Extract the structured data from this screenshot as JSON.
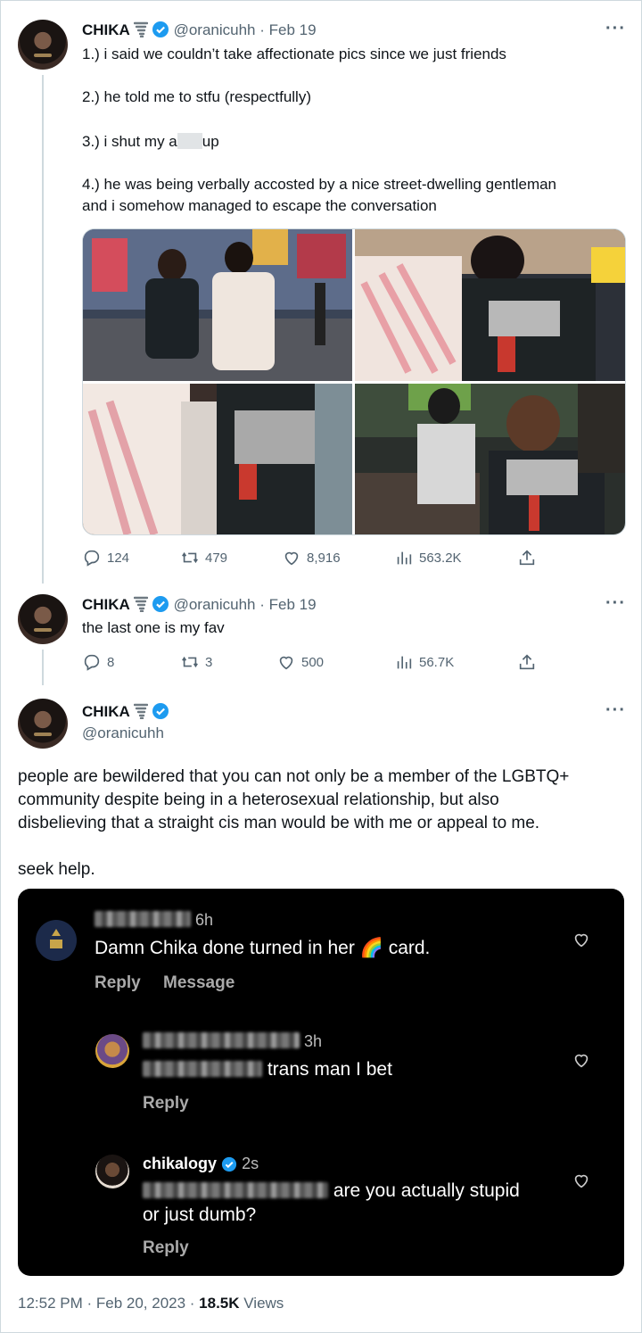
{
  "tweet1": {
    "name": "CHIKA",
    "handle": "@oranicuhh",
    "date": "· Feb 19",
    "lines": [
      "1.) i said we couldn’t take affectionate pics since we just friends",
      "2.) he told me to stfu (respectfully)",
      "3.) i shut my a",
      "up",
      "4.) he was being verbally accosted by a nice street-dwelling gentleman",
      "and i somehow managed to escape the conversation"
    ],
    "stats": {
      "replies": "124",
      "retweets": "479",
      "likes": "8,916",
      "views": "563.2K"
    }
  },
  "tweet2": {
    "name": "CHIKA",
    "handle": "@oranicuhh",
    "date": "· Feb 19",
    "text": "the last one is my fav",
    "stats": {
      "replies": "8",
      "retweets": "3",
      "likes": "500",
      "views": "56.7K"
    }
  },
  "main": {
    "name": "CHIKA",
    "handle": "@oranicuhh",
    "paragraph_lines": [
      "people are bewildered that you can not only be a member of the LGBTQ+",
      "community despite being in a heterosexual relationship, but also",
      "disbelieving that a straight cis man would be with me or appeal to me."
    ],
    "closing": "seek help."
  },
  "embed": {
    "comment1": {
      "time": "6h",
      "text_before": "Damn Chika done turned in her",
      "emoji": "🌈",
      "text_after": "card.",
      "reply": "Reply",
      "message": "Message"
    },
    "comment2": {
      "time": "3h",
      "text": "trans man I bet",
      "reply": "Reply"
    },
    "comment3": {
      "user": "chikalogy",
      "time": "2s",
      "text_line1": "are you actually stupid",
      "text_line2": "or just dumb?",
      "reply": "Reply"
    }
  },
  "footer": {
    "time": "12:52 PM · Feb 20, 2023 · ",
    "views": "18.5K",
    "views_label": " Views"
  },
  "icons": [
    "reply-icon",
    "retweet-icon",
    "like-icon",
    "views-icon",
    "share-icon",
    "verified-icon",
    "tornado-icon",
    "more-icon",
    "heart-icon"
  ],
  "colors": {
    "verified": "#1d9bf0",
    "muted": "#536471",
    "border": "#cfd9de"
  }
}
